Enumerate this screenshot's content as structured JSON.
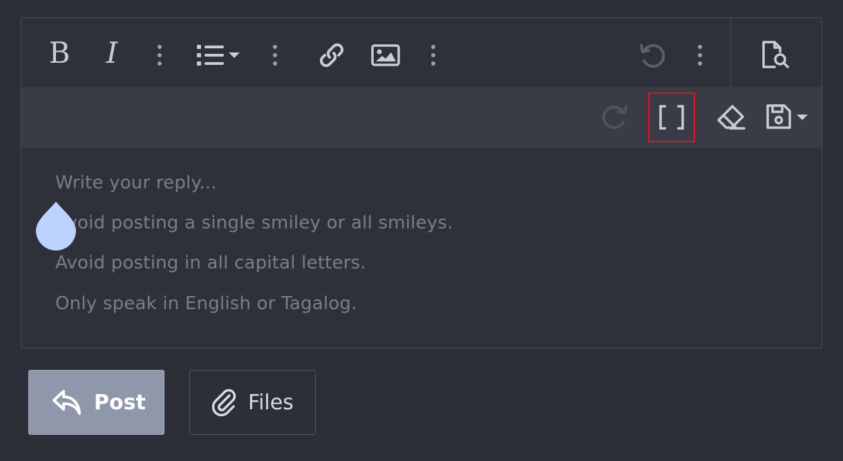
{
  "toolbar": {
    "bold": "B",
    "italic": "I",
    "icons": [
      "bold-icon",
      "italic-icon",
      "more-text-options-icon",
      "list-dropdown-icon",
      "more-paragraph-options-icon",
      "link-icon",
      "image-icon",
      "more-insert-options-icon",
      "undo-icon",
      "more-options-icon",
      "preview-icon",
      "redo-icon",
      "bbcode-toggle-icon",
      "remove-formatting-icon",
      "drafts-icon"
    ]
  },
  "editor": {
    "placeholder_lines": [
      "Write your reply...",
      "Avoid posting a single smiley or all smileys.",
      "Avoid posting in all capital letters.",
      "Only speak in English or Tagalog."
    ]
  },
  "actions": {
    "post_label": "Post",
    "files_label": "Files"
  },
  "colors": {
    "background": "#2c2f37",
    "toolbar_secondary": "#393c46",
    "highlight": "#e0141b",
    "post_button": "#8f98ab",
    "cursor_drop": "#bcd3ff"
  }
}
